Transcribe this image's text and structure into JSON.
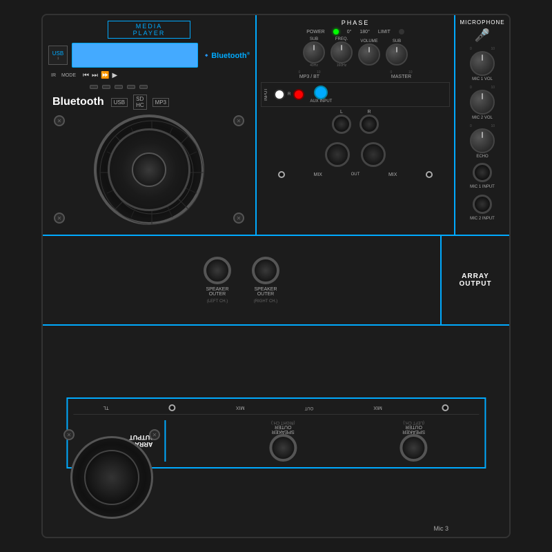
{
  "device": {
    "media_player_label": "MEDIA PLAYER",
    "bluetooth_text": "Bluetooth",
    "usb_label": "USB",
    "ir_label": "IR",
    "mode_label": "MODE",
    "phase_label": "PHASE",
    "power_label": "POWER",
    "limit_label": "LIMIT",
    "degree_0": "0°",
    "degree_180": "180°",
    "sub_label": "SUB",
    "freq_label": "FREQ.",
    "volume_label": "VOLUME",
    "hz_40": "40Hz",
    "hz_160": "160Hz",
    "mp3_bt_label": "MP3 / BT",
    "master_label": "MASTER",
    "input_label": "INPUT",
    "aux_input_label": "AUX INPUT",
    "r_label": "R",
    "l_label": "L",
    "mix_label": "MIX",
    "out_label": "OUT",
    "microphone_label": "MICROPHONE",
    "mic1_vol_label": "MIC 1 VOL",
    "mic2_vol_label": "MIC 2 VOL",
    "echo_label": "ECHO",
    "mic1_input_label": "MIC 1\nINPUT",
    "mic2_input_label": "MIC 2\nINPUT",
    "array_output_label": "ARRAY\nOUTPUT",
    "speaker_outer_left_label": "SPEAKER\nOUTER",
    "speaker_outer_left_ch": "(LEFT CH.)",
    "speaker_outer_right_label": "SPEAKER\nOUTER",
    "speaker_outer_right_ch": "(RIGHT CH.)",
    "mic3_label": "Mic 3"
  }
}
